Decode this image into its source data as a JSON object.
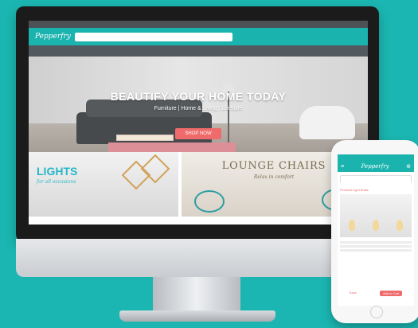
{
  "website": {
    "logo": "Pepperfry",
    "hero": {
      "headline": "BEAUTIFY YOUR HOME TODAY",
      "subheadline": "Furniture | Home & Living | Lifestyle",
      "cta": "SHOP NOW"
    },
    "tiles": {
      "lights": {
        "title": "LIGHTS",
        "subtitle": "for all occasions"
      },
      "lounge": {
        "title": "LOUNGE CHAIRS",
        "subtitle": "Relax in comfort"
      }
    }
  },
  "phone": {
    "section_title": "Pendant Light Bulbs",
    "actions": {
      "save": "Save",
      "cart": "Add to Cart"
    }
  }
}
